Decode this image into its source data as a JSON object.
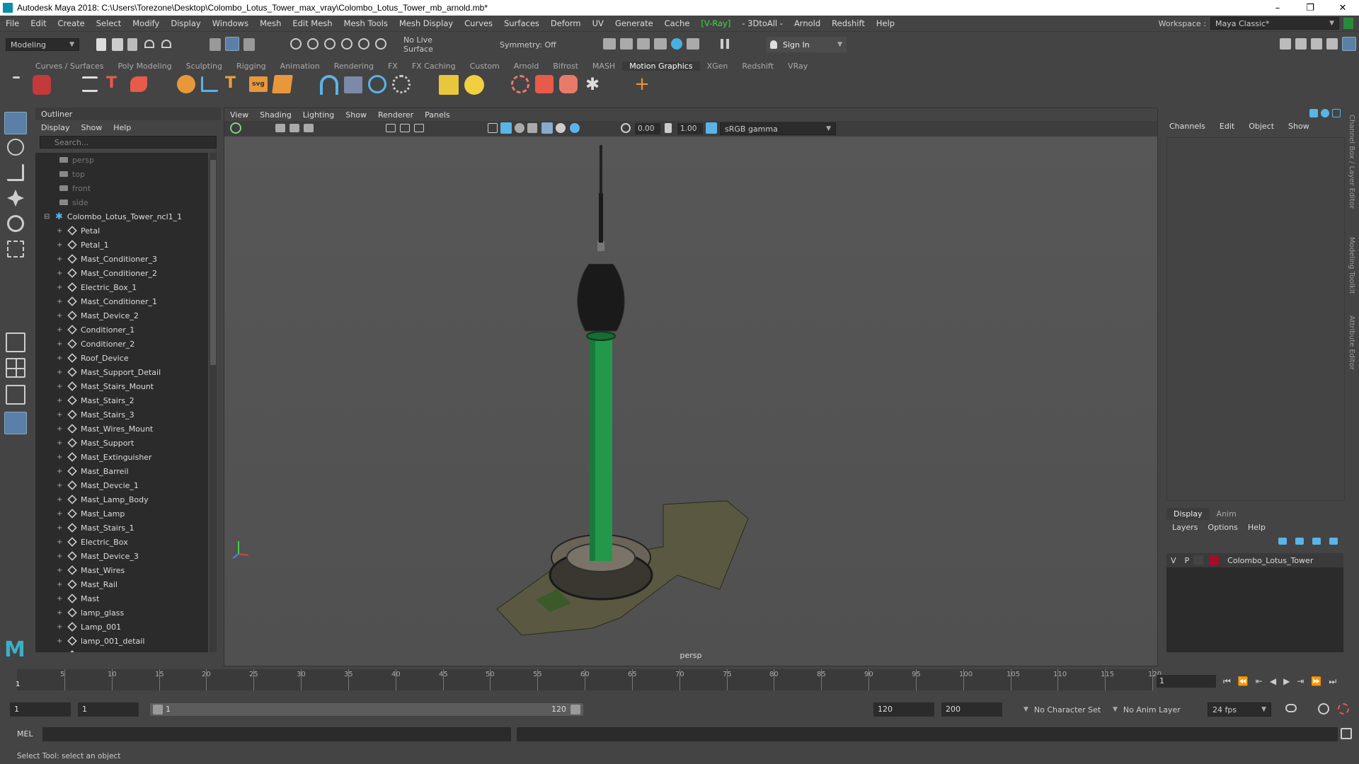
{
  "window": {
    "title": "Autodesk Maya 2018: C:\\Users\\Torezone\\Desktop\\Colombo_Lotus_Tower_max_vray\\Colombo_Lotus_Tower_mb_arnold.mb*",
    "controls": [
      "–",
      "❐",
      "✕"
    ]
  },
  "menubar": {
    "items": [
      "File",
      "Edit",
      "Create",
      "Select",
      "Modify",
      "Display",
      "Windows",
      "Mesh",
      "Edit Mesh",
      "Mesh Tools",
      "Mesh Display",
      "Curves",
      "Surfaces",
      "Deform",
      "UV",
      "Generate",
      "Cache",
      "[V-Ray]",
      "- 3DtoAll -",
      "Arnold",
      "Redshift",
      "Help"
    ],
    "workspace_label": "Workspace :",
    "workspace_value": "Maya Classic*"
  },
  "statusline": {
    "mode": "Modeling",
    "live_surface": "No Live Surface",
    "symmetry": "Symmetry: Off",
    "sign_in": "Sign In"
  },
  "shelf": {
    "tabs": [
      "Curves / Surfaces",
      "Poly Modeling",
      "Sculpting",
      "Rigging",
      "Animation",
      "Rendering",
      "FX",
      "FX Caching",
      "Custom",
      "Arnold",
      "Bifrost",
      "MASH",
      "Motion Graphics",
      "XGen",
      "Redshift",
      "VRay"
    ],
    "active_tab": "Motion Graphics"
  },
  "outliner": {
    "title": "Outliner",
    "menu": [
      "Display",
      "Show",
      "Help"
    ],
    "search_placeholder": "Search...",
    "cameras": [
      "persp",
      "top",
      "front",
      "side"
    ],
    "group": "Colombo_Lotus_Tower_ncl1_1",
    "items": [
      "Petal",
      "Petal_1",
      "Mast_Conditioner_3",
      "Mast_Conditioner_2",
      "Electric_Box_1",
      "Mast_Conditioner_1",
      "Mast_Device_2",
      "Conditioner_1",
      "Conditioner_2",
      "Roof_Device",
      "Mast_Support_Detail",
      "Mast_Stairs_Mount",
      "Mast_Stairs_2",
      "Mast_Stairs_3",
      "Mast_Wires_Mount",
      "Mast_Support",
      "Mast_Extinguisher",
      "Mast_Barreil",
      "Mast_Devcie_1",
      "Mast_Lamp_Body",
      "Mast_Lamp",
      "Mast_Stairs_1",
      "Electric_Box",
      "Mast_Device_3",
      "Mast_Wires",
      "Mast_Rail",
      "Mast",
      "lamp_glass",
      "Lamp_001",
      "lamp_001_detail",
      "lamp_001_detail_01"
    ]
  },
  "viewport": {
    "menu": [
      "View",
      "Shading",
      "Lighting",
      "Show",
      "Renderer",
      "Panels"
    ],
    "exposure": "0.00",
    "gamma": "1.00",
    "color_space": "sRGB gamma",
    "camera": "persp"
  },
  "channelbox": {
    "menu": [
      "Channels",
      "Edit",
      "Object",
      "Show"
    ],
    "side_tabs": [
      "Channel Box / Layer Editor",
      "Modeling Toolkit",
      "Attribute Editor"
    ]
  },
  "layers": {
    "tabs": [
      "Display",
      "Anim"
    ],
    "menu": [
      "Layers",
      "Options",
      "Help"
    ],
    "rows": [
      {
        "v": "V",
        "p": "P",
        "name": "Colombo_Lotus_Tower",
        "color": "#a0102a"
      }
    ]
  },
  "timeline": {
    "labels": [
      "5",
      "10",
      "15",
      "20",
      "25",
      "30",
      "35",
      "40",
      "45",
      "50",
      "55",
      "60",
      "65",
      "70",
      "75",
      "80",
      "85",
      "90",
      "95",
      "100",
      "105",
      "110",
      "115",
      "120"
    ],
    "current_marker": "1",
    "current_frame": "1"
  },
  "range": {
    "start": "1",
    "playback_start": "1",
    "bar_start": "1",
    "bar_end": "120",
    "playback_end": "120",
    "end": "200",
    "character_set": "No Character Set",
    "anim_layer": "No Anim Layer",
    "fps": "24 fps"
  },
  "cmdline": {
    "label": "MEL"
  },
  "helpline": {
    "text": "Select Tool: select an object"
  }
}
